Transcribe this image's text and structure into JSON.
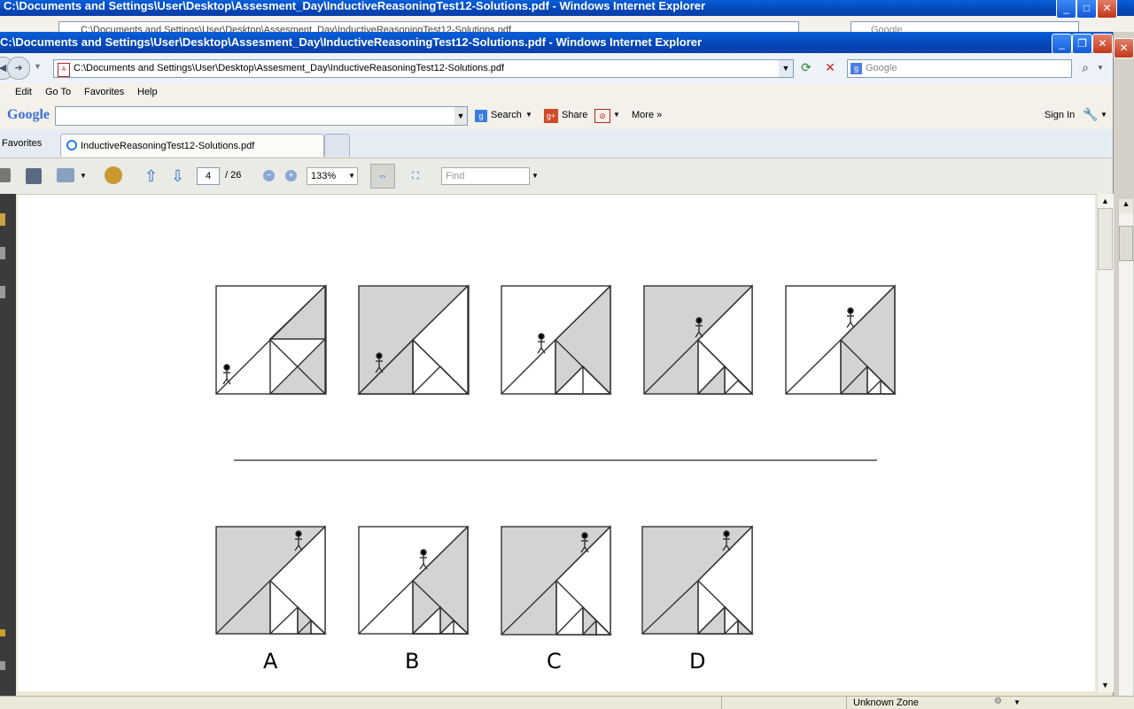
{
  "back_window": {
    "title": "C:\\Documents and Settings\\User\\Desktop\\Assesment_Day\\InductiveReasoningTest12-Solutions.pdf - Windows Internet Explorer",
    "address": "C:\\Documents and Settings\\User\\Desktop\\Assesment_Day\\InductiveReasoningTest12-Solutions.pdf",
    "search_placeholder": "Google"
  },
  "window": {
    "title": "C:\\Documents and Settings\\User\\Desktop\\Assesment_Day\\InductiveReasoningTest12-Solutions.pdf - Windows Internet Explorer",
    "address": "C:\\Documents and Settings\\User\\Desktop\\Assesment_Day\\InductiveReasoningTest12-Solutions.pdf",
    "search_placeholder": "Google"
  },
  "menu": [
    "Edit",
    "Go To",
    "Favorites",
    "Help"
  ],
  "google_toolbar": {
    "logo": "Google",
    "search_label": "Search",
    "share_label": "Share",
    "more_label": "More »",
    "sign_in_label": "Sign In"
  },
  "tabs_bar": {
    "favorites_label": "Favorites",
    "active_tab": "InductiveReasoningTest12-Solutions.pdf"
  },
  "pdf_toolbar": {
    "page_current": "4",
    "page_total": "/ 26",
    "zoom": "133%",
    "find_placeholder": "Find"
  },
  "document": {
    "answer_labels": [
      "A",
      "B",
      "C",
      "D"
    ]
  },
  "status_bar": {
    "zone": "Unknown Zone"
  },
  "colors": {
    "titlebar": "#0a5fd8",
    "figure_fill": "#d3d3d3",
    "figure_stroke": "#333333"
  }
}
